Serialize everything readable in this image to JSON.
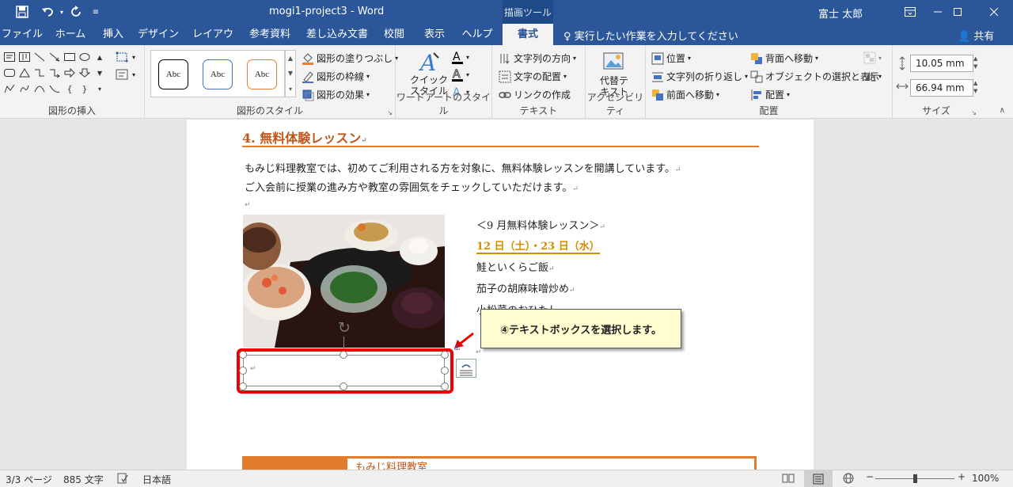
{
  "titlebar": {
    "doc_title": "mogi1-project3  -  Word",
    "context_tab_group": "描画ツール",
    "user_name": "富士 太郎",
    "qat": [
      "save-icon",
      "undo-icon",
      "redo-icon",
      "customize-icon"
    ],
    "window_controls": [
      "ribbon-display-icon",
      "minimize-icon",
      "maximize-icon",
      "close-icon"
    ]
  },
  "tabs": [
    {
      "label": "ファイル"
    },
    {
      "label": "ホーム"
    },
    {
      "label": "挿入"
    },
    {
      "label": "デザイン"
    },
    {
      "label": "レイアウト"
    },
    {
      "label": "参考資料"
    },
    {
      "label": "差し込み文書"
    },
    {
      "label": "校閲"
    },
    {
      "label": "表示"
    },
    {
      "label": "ヘルプ"
    },
    {
      "label": "書式",
      "active": true
    }
  ],
  "tell_me": "実行したい作業を入力してください",
  "share": "共有",
  "ribbon": {
    "insert_shapes": {
      "label": "図形の挿入"
    },
    "shape_styles": {
      "label": "図形のスタイル",
      "gallery": [
        "Abc",
        "Abc",
        "Abc"
      ],
      "gallery_colors": [
        "#000000",
        "#4472c4",
        "#ed7d31"
      ],
      "fill": "図形の塗りつぶし",
      "outline": "図形の枠線",
      "effects": "図形の効果"
    },
    "wordart": {
      "label": "ワードアートのスタイル",
      "quick_style": "クイック\nスタイル"
    },
    "text": {
      "label": "テキスト",
      "direction": "文字列の方向",
      "align": "文字の配置",
      "link": "リンクの作成"
    },
    "accessibility": {
      "label": "アクセシビリティ",
      "alt_text": "代替テ\nキスト"
    },
    "arrange": {
      "label": "配置",
      "position": "位置",
      "wrap": "文字列の折り返し",
      "forward": "前面へ移動",
      "backward": "背面へ移動",
      "selection_pane": "オブジェクトの選択と表示",
      "align": "配置"
    },
    "size": {
      "label": "サイズ",
      "height": "10.05 mm",
      "width": "66.94 mm"
    }
  },
  "document": {
    "heading": "4.  無料体験レッスン",
    "para1": "もみじ料理教室では、初めてご利用される方を対象に、無料体験レッスンを開講しています。",
    "para2": "ご入会前に授業の進み方や教室の雰囲気をチェックしていただけます。",
    "lesson_title": "＜9 月無料体験レッスン＞",
    "lesson_dates": "12 日（土）・23 日（水）",
    "menu": [
      "鮭といくらご飯",
      "茄子の胡麻味噌炒め",
      "小松菜のおひたし"
    ],
    "callout": "④テキストボックスを選択します。",
    "banner_text": "もみじ料理教室"
  },
  "status": {
    "page": "3/3 ページ",
    "words": "885 文字",
    "language": "日本語",
    "zoom": "100%",
    "zoom_level": 100
  }
}
